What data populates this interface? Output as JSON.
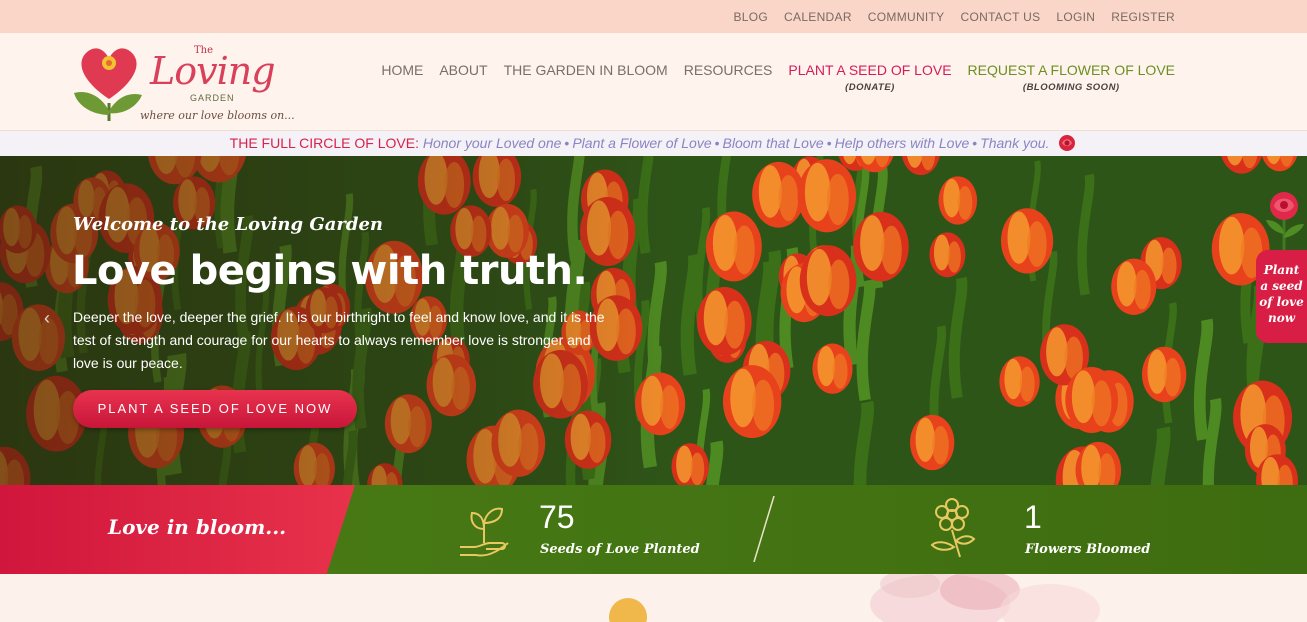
{
  "topbar": {
    "links": [
      "BLOG",
      "CALENDAR",
      "COMMUNITY",
      "CONTACT US",
      "LOGIN",
      "REGISTER"
    ]
  },
  "logo": {
    "the": "The",
    "loving": "Loving",
    "garden": "GARDEN",
    "tagline": "where our love blooms on..."
  },
  "nav": {
    "home": "HOME",
    "about": "ABOUT",
    "garden": "THE GARDEN IN BLOOM",
    "resources": "RESOURCES",
    "donate": "PLANT A SEED OF LOVE",
    "donate_sub": "(DONATE)",
    "request": "REQUEST A FLOWER OF LOVE",
    "request_sub": "(BLOOMING SOON)"
  },
  "strip": {
    "lead": "THE FULL CIRCLE OF LOVE:",
    "items": [
      "Honor your Loved one",
      "Plant a Flower of Love",
      "Bloom that Love",
      "Help others with Love",
      "Thank you."
    ],
    "separator": "•"
  },
  "hero": {
    "welcome": "Welcome to the Loving Garden",
    "title": "Love begins with truth.",
    "body": "Deeper the love, deeper the grief. It is our birthright to feel and know love, and it is the test of strength and courage for our hearts to always remember love is stronger and love is our peace.",
    "cta": "PLANT A SEED OF LOVE NOW",
    "prev_arrow": "‹"
  },
  "side_tab": {
    "lines": [
      "Plant",
      "a seed",
      "of love",
      "now"
    ]
  },
  "stats": {
    "heading": "Love in bloom...",
    "seeds": {
      "value": "75",
      "label": "Seeds of Love Planted",
      "icon": "seedling-hand-icon"
    },
    "flowers": {
      "value": "1",
      "label": "Flowers Bloomed",
      "icon": "flower-icon"
    }
  },
  "colors": {
    "accent_red": "#d41d5a",
    "accent_green": "#6d8f22",
    "stats_green": "#4a7d15",
    "stats_red": "#d0163c",
    "strip_italic": "#8a84c4"
  }
}
